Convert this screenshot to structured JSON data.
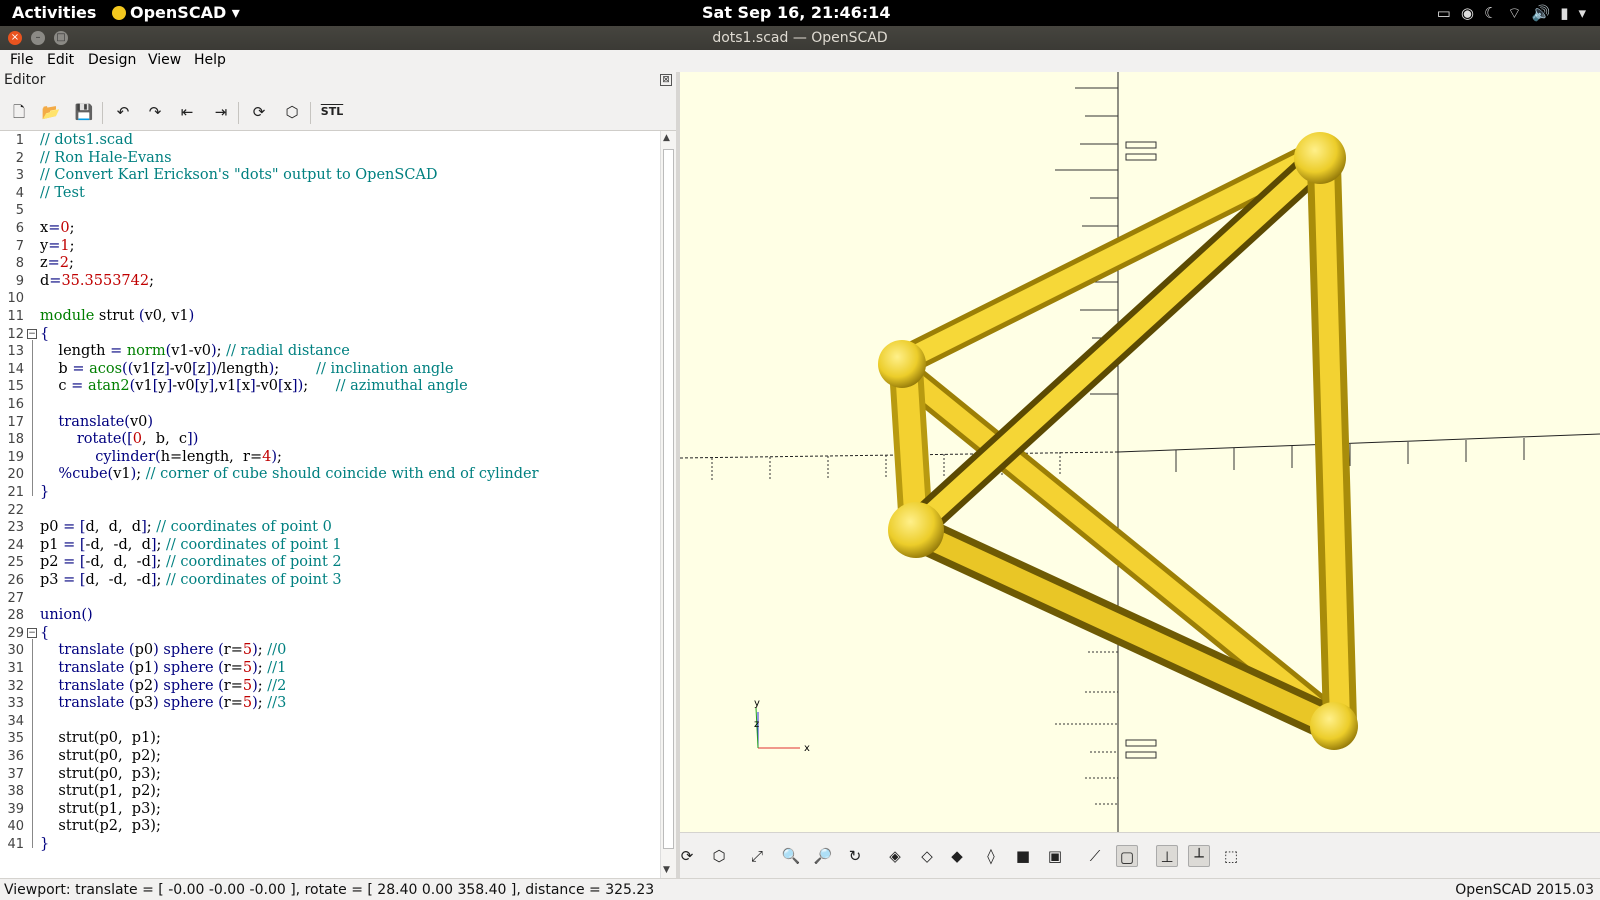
{
  "topbar": {
    "activities": "Activities",
    "app_menu": "OpenSCAD ▾",
    "clock": "Sat Sep 16, 21:46:14"
  },
  "window": {
    "title": "dots1.scad — OpenSCAD"
  },
  "menu": {
    "file": "File",
    "edit": "Edit",
    "design": "Design",
    "view": "View",
    "help": "Help"
  },
  "editor": {
    "label": "Editor",
    "close": "⊠",
    "toolbar": {
      "new_icon": "🗋",
      "open_icon": "📂",
      "save_icon": "💾",
      "undo_icon": "↶",
      "redo_icon": "↷",
      "unindent_icon": "⇤",
      "indent_icon": "⇥",
      "preview_icon": "⟳",
      "render_icon": "⬡",
      "stl_label": "STL"
    },
    "lines": [
      [
        [
          "c-com",
          "// dots1.scad"
        ]
      ],
      [
        [
          "c-com",
          "// Ron Hale-Evans"
        ]
      ],
      [
        [
          "c-com",
          "// Convert Karl Erickson's \"dots\" output to OpenSCAD"
        ]
      ],
      [
        [
          "c-com",
          "// Test"
        ]
      ],
      [],
      [
        [
          "c-var",
          "x"
        ],
        [
          "c-fn",
          "="
        ],
        [
          "c-num",
          "0"
        ],
        [
          "c-var",
          ";"
        ]
      ],
      [
        [
          "c-var",
          "y"
        ],
        [
          "c-fn",
          "="
        ],
        [
          "c-num",
          "1"
        ],
        [
          "c-var",
          ";"
        ]
      ],
      [
        [
          "c-var",
          "z"
        ],
        [
          "c-fn",
          "="
        ],
        [
          "c-num",
          "2"
        ],
        [
          "c-var",
          ";"
        ]
      ],
      [
        [
          "c-var",
          "d"
        ],
        [
          "c-fn",
          "="
        ],
        [
          "c-num",
          "35.3553742"
        ],
        [
          "c-var",
          ";"
        ]
      ],
      [],
      [
        [
          "c-kw",
          "module"
        ],
        [
          "c-var",
          " strut "
        ],
        [
          "c-fn",
          "("
        ],
        [
          "c-var",
          "v0, v1"
        ],
        [
          "c-fn",
          ")"
        ]
      ],
      [
        [
          "c-fn",
          "{"
        ]
      ],
      [
        [
          "c-var",
          "    length "
        ],
        [
          "c-fn",
          "= "
        ],
        [
          "c-kw",
          "norm"
        ],
        [
          "c-fn",
          "("
        ],
        [
          "c-var",
          "v1-v0"
        ],
        [
          "c-fn",
          ")"
        ],
        [
          "c-var",
          "; "
        ],
        [
          "c-com",
          "// radial distance"
        ]
      ],
      [
        [
          "c-var",
          "    b "
        ],
        [
          "c-fn",
          "= "
        ],
        [
          "c-kw",
          "acos"
        ],
        [
          "c-fn",
          "(("
        ],
        [
          "c-var",
          "v1"
        ],
        [
          "c-fn",
          "["
        ],
        [
          "c-var",
          "z"
        ],
        [
          "c-fn",
          "]"
        ],
        [
          "c-var",
          "-v0"
        ],
        [
          "c-fn",
          "["
        ],
        [
          "c-var",
          "z"
        ],
        [
          "c-fn",
          "])"
        ],
        [
          "c-var",
          "/length"
        ],
        [
          "c-fn",
          ")"
        ],
        [
          "c-var",
          ";        "
        ],
        [
          "c-com",
          "// inclination angle"
        ]
      ],
      [
        [
          "c-var",
          "    c "
        ],
        [
          "c-fn",
          "= "
        ],
        [
          "c-kw",
          "atan2"
        ],
        [
          "c-fn",
          "("
        ],
        [
          "c-var",
          "v1"
        ],
        [
          "c-fn",
          "["
        ],
        [
          "c-var",
          "y"
        ],
        [
          "c-fn",
          "]"
        ],
        [
          "c-var",
          "-v0"
        ],
        [
          "c-fn",
          "["
        ],
        [
          "c-var",
          "y"
        ],
        [
          "c-fn",
          "]"
        ],
        [
          "c-var",
          ",v1"
        ],
        [
          "c-fn",
          "["
        ],
        [
          "c-var",
          "x"
        ],
        [
          "c-fn",
          "]"
        ],
        [
          "c-var",
          "-v0"
        ],
        [
          "c-fn",
          "["
        ],
        [
          "c-var",
          "x"
        ],
        [
          "c-fn",
          "]"
        ],
        [
          "c-fn",
          ")"
        ],
        [
          "c-var",
          ";      "
        ],
        [
          "c-com",
          "// azimuthal angle"
        ]
      ],
      [],
      [
        [
          "c-fn",
          "    translate("
        ],
        [
          "c-var",
          "v0"
        ],
        [
          "c-fn",
          ")"
        ]
      ],
      [
        [
          "c-fn",
          "        rotate(["
        ],
        [
          "c-num",
          "0"
        ],
        [
          "c-var",
          ",  b,  c"
        ],
        [
          "c-fn",
          "])"
        ]
      ],
      [
        [
          "c-fn",
          "            cylinder("
        ],
        [
          "c-var",
          "h=length,  r="
        ],
        [
          "c-num",
          "4"
        ],
        [
          "c-fn",
          ")"
        ],
        [
          "c-var",
          ";"
        ]
      ],
      [
        [
          "c-fn",
          "    %cube("
        ],
        [
          "c-var",
          "v1"
        ],
        [
          "c-fn",
          ")"
        ],
        [
          "c-var",
          "; "
        ],
        [
          "c-com",
          "// corner of cube should coincide with end of cylinder"
        ]
      ],
      [
        [
          "c-fn",
          "}"
        ]
      ],
      [],
      [
        [
          "c-var",
          "p0 "
        ],
        [
          "c-fn",
          "= ["
        ],
        [
          "c-var",
          "d,  d,  d"
        ],
        [
          "c-fn",
          "]"
        ],
        [
          "c-var",
          "; "
        ],
        [
          "c-com",
          "// coordinates of point 0"
        ]
      ],
      [
        [
          "c-var",
          "p1 "
        ],
        [
          "c-fn",
          "= ["
        ],
        [
          "c-var",
          "-d,  -d,  d"
        ],
        [
          "c-fn",
          "]"
        ],
        [
          "c-var",
          "; "
        ],
        [
          "c-com",
          "// coordinates of point 1"
        ]
      ],
      [
        [
          "c-var",
          "p2 "
        ],
        [
          "c-fn",
          "= ["
        ],
        [
          "c-var",
          "-d,  d,  -d"
        ],
        [
          "c-fn",
          "]"
        ],
        [
          "c-var",
          "; "
        ],
        [
          "c-com",
          "// coordinates of point 2"
        ]
      ],
      [
        [
          "c-var",
          "p3 "
        ],
        [
          "c-fn",
          "= ["
        ],
        [
          "c-var",
          "d,  -d,  -d"
        ],
        [
          "c-fn",
          "]"
        ],
        [
          "c-var",
          "; "
        ],
        [
          "c-com",
          "// coordinates of point 3"
        ]
      ],
      [],
      [
        [
          "c-fn",
          "union()"
        ]
      ],
      [
        [
          "c-fn",
          "{"
        ]
      ],
      [
        [
          "c-fn",
          "    translate "
        ],
        [
          "c-fn",
          "("
        ],
        [
          "c-var",
          "p0"
        ],
        [
          "c-fn",
          ") sphere ("
        ],
        [
          "c-var",
          "r="
        ],
        [
          "c-num",
          "5"
        ],
        [
          "c-fn",
          ")"
        ],
        [
          "c-var",
          "; "
        ],
        [
          "c-com",
          "//0"
        ]
      ],
      [
        [
          "c-fn",
          "    translate "
        ],
        [
          "c-fn",
          "("
        ],
        [
          "c-var",
          "p1"
        ],
        [
          "c-fn",
          ") sphere ("
        ],
        [
          "c-var",
          "r="
        ],
        [
          "c-num",
          "5"
        ],
        [
          "c-fn",
          ")"
        ],
        [
          "c-var",
          "; "
        ],
        [
          "c-com",
          "//1"
        ]
      ],
      [
        [
          "c-fn",
          "    translate "
        ],
        [
          "c-fn",
          "("
        ],
        [
          "c-var",
          "p2"
        ],
        [
          "c-fn",
          ") sphere ("
        ],
        [
          "c-var",
          "r="
        ],
        [
          "c-num",
          "5"
        ],
        [
          "c-fn",
          ")"
        ],
        [
          "c-var",
          "; "
        ],
        [
          "c-com",
          "//2"
        ]
      ],
      [
        [
          "c-fn",
          "    translate "
        ],
        [
          "c-fn",
          "("
        ],
        [
          "c-var",
          "p3"
        ],
        [
          "c-fn",
          ") sphere ("
        ],
        [
          "c-var",
          "r="
        ],
        [
          "c-num",
          "5"
        ],
        [
          "c-fn",
          ")"
        ],
        [
          "c-var",
          "; "
        ],
        [
          "c-com",
          "//3"
        ]
      ],
      [],
      [
        [
          "c-var",
          "    strut(p0,  p1);"
        ]
      ],
      [
        [
          "c-var",
          "    strut(p0,  p2);"
        ]
      ],
      [
        [
          "c-var",
          "    strut(p0,  p3);"
        ]
      ],
      [
        [
          "c-var",
          "    strut(p1,  p2);"
        ]
      ],
      [
        [
          "c-var",
          "    strut(p1,  p3);"
        ]
      ],
      [
        [
          "c-var",
          "    strut(p2,  p3);"
        ]
      ],
      [
        [
          "c-fn",
          "}"
        ]
      ]
    ]
  },
  "viewport_toolbar": {
    "preview_icon": "⟳",
    "render_icon": "⬡",
    "zoom_all_icon": "⤢",
    "zoom_in_icon": "🔍",
    "zoom_out_icon": "🔎",
    "reset_icon": "↻",
    "view_right_icon": "◈",
    "view_top_icon": "◇",
    "view_bottom_icon": "◆",
    "view_left_icon": "◊",
    "view_front_icon": "■",
    "view_back_icon": "▣",
    "perspective_icon": "⟋",
    "ortho_icon": "▢",
    "axes_icon": "⊥",
    "scale_icon": "┴",
    "edges_icon": "⬚"
  },
  "axes_gizmo": {
    "y": "y",
    "z": "z",
    "x": "x"
  },
  "colors": {
    "model": "#f9d72c",
    "model_dark": "#b89a10",
    "background": "#ffffe5"
  },
  "status": {
    "viewport": "Viewport: translate = [ -0.00 -0.00 -0.00 ], rotate = [ 28.40 0.00 358.40 ], distance = 325.23",
    "version": "OpenSCAD 2015.03"
  }
}
